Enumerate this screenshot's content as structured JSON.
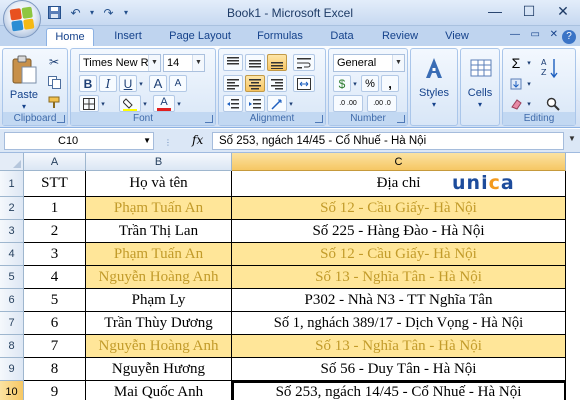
{
  "window": {
    "title": "Book1 - Microsoft Excel"
  },
  "tabs": [
    "Home",
    "Insert",
    "Page Layout",
    "Formulas",
    "Data",
    "Review",
    "View"
  ],
  "ribbon": {
    "groups": {
      "clipboard": "Clipboard",
      "font": "Font",
      "alignment": "Alignment",
      "number": "Number",
      "editing": "Editing"
    },
    "paste_label": "Paste",
    "font_name": "Times New Ro",
    "font_size": "14",
    "number_format": "General",
    "styles_label": "Styles",
    "cells_label": "Cells",
    "bold": "B",
    "italic": "I",
    "underline": "U",
    "font_color_glyph": "A",
    "grow_font": "A",
    "shrink_font": "A",
    "currency": "$",
    "percent": "%",
    "comma": ",",
    "inc_decimal": ".0 .00",
    "dec_decimal": ".00 .0",
    "sum": "Σ"
  },
  "formula_bar": {
    "name_box": "C10",
    "fx": "fx",
    "content": "Số 253, ngách 14/45 - Cổ Nhuế - Hà Nội"
  },
  "sheet": {
    "columns": [
      "A",
      "B",
      "C"
    ],
    "active_column": "C",
    "active_row": "10",
    "rows": [
      {
        "num": "1",
        "cells": [
          "STT",
          "Họ và tên",
          "Địa chỉ"
        ],
        "highlight": false
      },
      {
        "num": "2",
        "cells": [
          "1",
          "Phạm Tuấn An",
          "Số 12 - Cầu Giấy- Hà Nội"
        ],
        "highlight": true
      },
      {
        "num": "3",
        "cells": [
          "2",
          "Trần Thị Lan",
          "Số 225 - Hàng Đào - Hà Nội"
        ],
        "highlight": false
      },
      {
        "num": "4",
        "cells": [
          "3",
          "Phạm Tuấn An",
          "Số 12 - Cầu Giấy- Hà Nội"
        ],
        "highlight": true
      },
      {
        "num": "5",
        "cells": [
          "4",
          "Nguyễn Hoàng Anh",
          "Số 13 - Nghĩa Tân - Hà Nội"
        ],
        "highlight": true
      },
      {
        "num": "6",
        "cells": [
          "5",
          "Phạm Ly",
          "P302 - Nhà N3 - TT Nghĩa Tân"
        ],
        "highlight": false
      },
      {
        "num": "7",
        "cells": [
          "6",
          "Trần Thùy Dương",
          "Số 1, nghách 389/17 - Dịch Vọng - Hà Nội"
        ],
        "highlight": false
      },
      {
        "num": "8",
        "cells": [
          "7",
          "Nguyễn Hoàng Anh",
          "Số 13 - Nghĩa Tân - Hà Nội"
        ],
        "highlight": true
      },
      {
        "num": "9",
        "cells": [
          "8",
          "Nguyễn Hương",
          "Số 56 - Duy Tân - Hà Nội"
        ],
        "highlight": false
      },
      {
        "num": "10",
        "cells": [
          "9",
          "Mai Quốc Anh",
          "Số 253, ngách 14/45 - Cổ Nhuế - Hà Nội"
        ],
        "highlight": false
      }
    ]
  },
  "watermark": {
    "letters": [
      "u",
      "n",
      "i",
      "c",
      "a"
    ],
    "colors": [
      "#1d4c9c",
      "#1d4c9c",
      "#1d4c9c",
      "#f39a1e",
      "#1d4c9c"
    ]
  },
  "colors": {
    "highlight_fill": "#ffe699",
    "highlight_text": "#c29b2a",
    "accent": "#15428b"
  }
}
